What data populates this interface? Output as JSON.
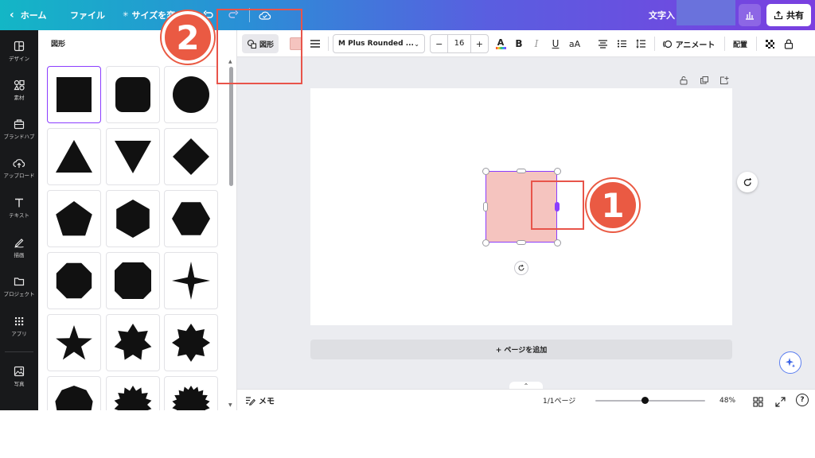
{
  "topbar": {
    "home_label": "ホーム",
    "file_label": "ファイル",
    "resize_label": "サイズを変",
    "doc_title": "文字入",
    "share_label": "共有"
  },
  "rail": {
    "items": [
      {
        "label": "デザイン",
        "icon": "layout-icon"
      },
      {
        "label": "素材",
        "icon": "elements-icon"
      },
      {
        "label": "ブランドハブ",
        "icon": "brand-icon"
      },
      {
        "label": "アップロード",
        "icon": "upload-icon"
      },
      {
        "label": "テキスト",
        "icon": "text-icon"
      },
      {
        "label": "描画",
        "icon": "draw-icon"
      },
      {
        "label": "プロジェクト",
        "icon": "folder-icon"
      },
      {
        "label": "アプリ",
        "icon": "apps-icon"
      },
      {
        "label": "写真",
        "icon": "photo-icon"
      }
    ]
  },
  "panel": {
    "title": "図形",
    "shapes": [
      "square",
      "rounded-square",
      "circle",
      "triangle",
      "inverted-triangle",
      "diamond",
      "pentagon",
      "hexagon",
      "hexagon-flat",
      "octagon",
      "octagon-cut",
      "four-point-star",
      "five-point-star",
      "seven-point-star",
      "eight-point-star",
      "nonagon",
      "sunburst-12",
      "sunburst-16"
    ]
  },
  "toolbar": {
    "shape_label": "図形",
    "font_name": "M Plus Rounded ...",
    "font_size": "16",
    "minus": "−",
    "plus": "+",
    "bold": "B",
    "italic": "I",
    "underline": "U",
    "case": "aA",
    "animate_label": "アニメート",
    "position_label": "配置",
    "fill_color": "#f5c4bf"
  },
  "canvas": {
    "add_page_label": "+ ページを追加"
  },
  "bottom": {
    "notes_label": "メモ",
    "page_indicator": "1/1ページ",
    "zoom": "48%",
    "zoom_fraction": 0.45,
    "help": "?"
  },
  "callouts": {
    "one": "1",
    "two": "2",
    "accent": "#ea5a43"
  }
}
